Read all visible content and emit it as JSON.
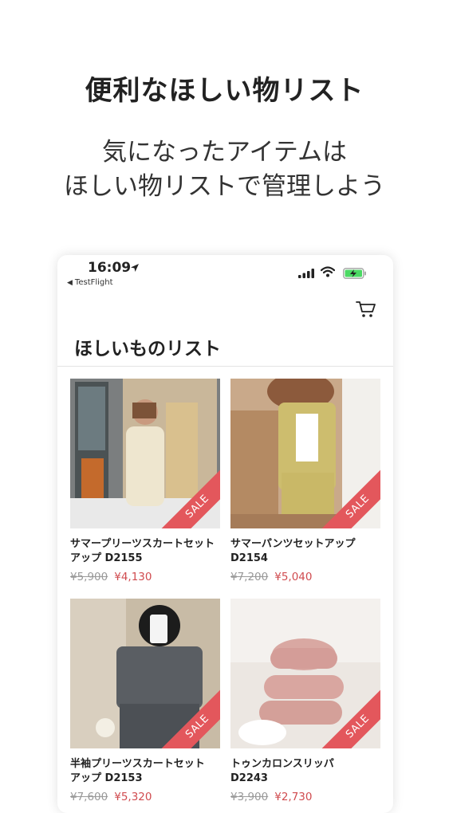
{
  "promo": {
    "headline": "便利なほしい物リスト",
    "sub_line1": "気になったアイテムは",
    "sub_line2": "ほしい物リストで管理しよう"
  },
  "status_bar": {
    "time": "16:09",
    "back_app": "TestFlight"
  },
  "page": {
    "title": "ほしいものリスト"
  },
  "colors": {
    "sale": "#e3575c",
    "price_new": "#d04b4f",
    "price_old": "#999999",
    "battery": "#4cd964"
  },
  "products": [
    {
      "name_line1": "サマープリーツスカートセット",
      "name_line2": "アップ D2155",
      "old_price": "¥5,900",
      "new_price": "¥4,130",
      "badge": "SALE"
    },
    {
      "name_line1": "サマーパンツセットアップ",
      "name_line2": "D2154",
      "old_price": "¥7,200",
      "new_price": "¥5,040",
      "badge": "SALE"
    },
    {
      "name_line1": "半袖プリーツスカートセット",
      "name_line2": "アップ D2153",
      "old_price": "¥7,600",
      "new_price": "¥5,320",
      "badge": "SALE"
    },
    {
      "name_line1": "トゥンカロンスリッパ",
      "name_line2": "D2243",
      "old_price": "¥3,900",
      "new_price": "¥2,730",
      "badge": "SALE"
    }
  ]
}
